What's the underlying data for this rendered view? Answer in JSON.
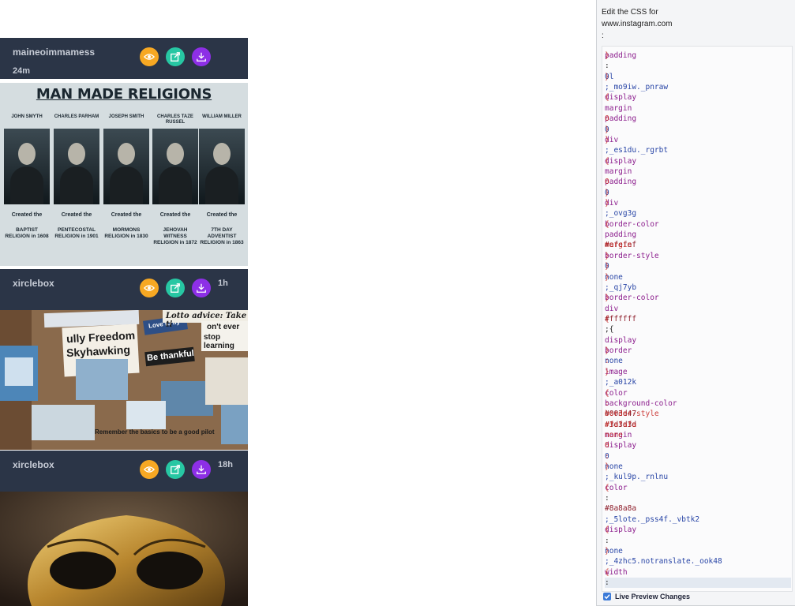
{
  "feed": {
    "posts": [
      {
        "username": "maineoimmamess",
        "time": "24m"
      },
      {
        "username": "xirclebox",
        "time": "1h"
      },
      {
        "username": "xirclebox",
        "time": "18h"
      }
    ]
  },
  "photo1": {
    "title": "MAN MADE RELIGIONS",
    "columns": [
      {
        "name": "JOHN SMYTH",
        "created": "Created the",
        "religion": "BAPTIST RELIGION in 1608"
      },
      {
        "name": "CHARLES PARHAM",
        "created": "Created the",
        "religion": "PENTECOSTAL RELIGION in 1901"
      },
      {
        "name": "JOSEPH SMITH",
        "created": "Created the",
        "religion": "MORMONS RELIGION in 1830"
      },
      {
        "name": "CHARLES TAZE RUSSEL",
        "created": "Created the",
        "religion": "JEHOVAH WITNESS RELIGION in 1872"
      },
      {
        "name": "WILLIAM MILLER",
        "created": "Created the",
        "religion": "7TH DAY ADVENTIST RELIGION in 1863"
      }
    ]
  },
  "photo2": {
    "texts": {
      "freedom": "ully Freedom",
      "skyhawking": "Skyhawking",
      "love": "Love to fly",
      "thankful": "Be thankful",
      "advice": "Lotto advice: Take ti",
      "never": "on't ever",
      "learning": "stop learning",
      "basics": "Remember the basics to be a good pilot"
    }
  },
  "panel": {
    "header_line1": "Edit the CSS for",
    "header_line2": "www.instagram.com",
    "header_line3": ":",
    "live_preview_label": "Live Preview Changes",
    "code_lines": [
      {
        "text": "padding",
        "cls": "tok-prop",
        "ghost": "}"
      },
      {
        "text": ":",
        "cls": "tok-punct",
        "ghost": ""
      },
      {
        "text": "0l",
        "cls": "tok-val",
        "ghost": "}"
      },
      {
        "text": ";_mo9iw._pnraw",
        "cls": "tok-sel",
        "ghost": ""
      },
      {
        "text": "display",
        "cls": "tok-prop",
        "ghost": "{"
      },
      {
        "text": "margin",
        "cls": "tok-prop",
        "ghost": ""
      },
      {
        "text": "padding",
        "cls": "tok-prop",
        "ghost": "0"
      },
      {
        "text": "0",
        "cls": "tok-val",
        "ghost": "}"
      },
      {
        "text": "div",
        "cls": "tok-prop",
        "ghost": "}"
      },
      {
        "text": ";_es1du._rgrbt",
        "cls": "tok-sel",
        "ghost": ""
      },
      {
        "text": "display",
        "cls": "tok-prop",
        "ghost": "{"
      },
      {
        "text": "margin",
        "cls": "tok-prop",
        "ghost": ""
      },
      {
        "text": "padding",
        "cls": "tok-prop",
        "ghost": "0"
      },
      {
        "text": "0",
        "cls": "tok-val",
        "ghost": "}"
      },
      {
        "text": "div",
        "cls": "tok-prop",
        "ghost": "}"
      },
      {
        "text": ";_ovg3g",
        "cls": "tok-sel",
        "ghost": ""
      },
      {
        "text": "border-color",
        "cls": "tok-prop",
        "ghost": "{"
      },
      {
        "text": "padding",
        "cls": "tok-prop",
        "ghost": ""
      },
      {
        "text": "#efefef",
        "cls": "tok-hex",
        "ghost": "margin"
      },
      {
        "text": "border-style",
        "cls": "tok-prop",
        "ghost": "}"
      },
      {
        "text": "0",
        "cls": "tok-val",
        "ghost": "}"
      },
      {
        "text": "none",
        "cls": "tok-val",
        "ghost": "}"
      },
      {
        "text": ";_qj7yb",
        "cls": "tok-sel",
        "ghost": ""
      },
      {
        "text": "border-color",
        "cls": "tok-prop",
        "ghost": "}"
      },
      {
        "text": "div",
        "cls": "tok-prop",
        "ghost": ""
      },
      {
        "text": "#ffffff",
        "cls": "tok-hex",
        "ghost": "{"
      },
      {
        "text": ";{",
        "cls": "tok-punct",
        "ghost": ""
      },
      {
        "text": "display",
        "cls": "tok-prop",
        "ghost": ""
      },
      {
        "text": "border",
        "cls": "tok-prop",
        "ghost": "}"
      },
      {
        "text": "none",
        "cls": "tok-val",
        "ghost": ":"
      },
      {
        "text": "image",
        "cls": "tok-prop",
        "ghost": "}"
      },
      {
        "text": ";_a012k",
        "cls": "tok-sel",
        "ghost": ""
      },
      {
        "text": "color",
        "cls": "tok-prop",
        "ghost": "{"
      },
      {
        "text": "background-color",
        "cls": "tok-prop",
        "ghost": ":"
      },
      {
        "text": "#003d47",
        "cls": "tok-hex",
        "ghost": "border-style"
      },
      {
        "text": "#3d3d3d",
        "cls": "tok-hex",
        "ghost": "#fafafa"
      },
      {
        "text": "margin",
        "cls": "tok-prop",
        "ghost": "none"
      },
      {
        "text": "display",
        "cls": "tok-prop",
        "ghost": "0"
      },
      {
        "text": "0",
        "cls": "tok-val",
        "ghost": ":"
      },
      {
        "text": "none",
        "cls": "tok-val",
        "ghost": "}"
      },
      {
        "text": ";_kul9p._rnlnu",
        "cls": "tok-sel",
        "ghost": ""
      },
      {
        "text": "color",
        "cls": "tok-prop",
        "ghost": "{"
      },
      {
        "text": ":",
        "cls": "tok-punct",
        "ghost": ""
      },
      {
        "text": "#8a8a8a",
        "cls": "tok-hex",
        "ghost": ""
      },
      {
        "text": ";_5lote._pss4f._vbtk2",
        "cls": "tok-sel",
        "ghost": ""
      },
      {
        "text": "display",
        "cls": "tok-prop",
        "ghost": "{"
      },
      {
        "text": ":",
        "cls": "tok-punct",
        "ghost": ""
      },
      {
        "text": "none",
        "cls": "tok-val",
        "ghost": "}"
      },
      {
        "text": ";_4zhc5.notranslate._ook48",
        "cls": "tok-sel",
        "ghost": ""
      },
      {
        "text": "width",
        "cls": "tok-prop",
        "ghost": "{"
      },
      {
        "text": ":",
        "cls": "tok-punct",
        "ghost": ""
      }
    ]
  }
}
